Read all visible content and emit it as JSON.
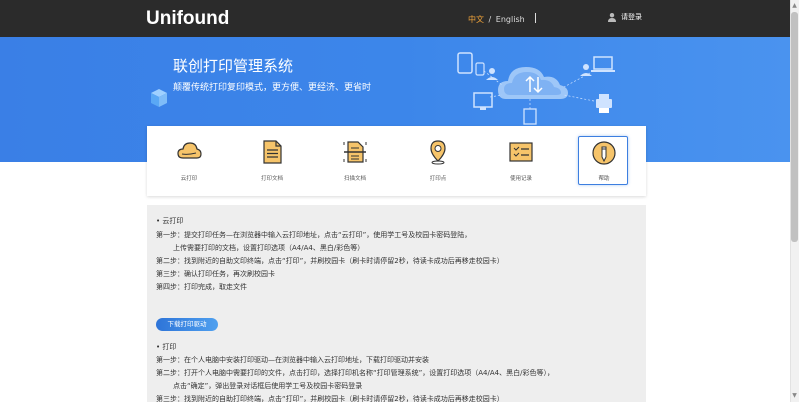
{
  "header": {
    "logo": "Unifound",
    "lang_zh": "中文",
    "lang_sep": "/",
    "lang_en": "English",
    "login": "请登录",
    "accent": "#f0a33a",
    "bg": "#2b2b2b"
  },
  "banner": {
    "title": "联创打印管理系统",
    "subtitle": "颠覆传统打印复印模式，更方便、更经济、更省时",
    "bg": "#3c86ea"
  },
  "cards": [
    {
      "icon": "cloud-print-icon",
      "label": "云打印"
    },
    {
      "icon": "document-icon",
      "label": "打印文档"
    },
    {
      "icon": "scan-document-icon",
      "label": "扫描文档"
    },
    {
      "icon": "location-pin-icon",
      "label": "打印点"
    },
    {
      "icon": "records-icon",
      "label": "使用记录"
    },
    {
      "icon": "help-pencil-icon",
      "label": "帮助",
      "active": true
    }
  ],
  "help": {
    "cloud_title": "• 云打印",
    "cloud_steps": [
      "第一步：提交打印任务—在浏览器中输入云打印地址，点击“云打印”，使用学工号及校园卡密码登陆，",
      "上传需要打印的文档，设置打印选项（A4/A4、黑白/彩色等）",
      "第二步：找到附近的自助文印终端，点击“打印”，并刷校园卡（刷卡时请停留2秒，待读卡成功后再移走校园卡）",
      "第三步：确认打印任务，再次刷校园卡",
      "第四步：打印完成，取走文件"
    ],
    "download_button": "下载打印驱动",
    "print_title": "• 打印",
    "print_steps": [
      "第一步：在个人电脑中安装打印驱动—在浏览器中输入云打印地址，下载打印驱动并安装",
      "第二步：打开个人电脑中需要打印的文件，点击打印，选择打印机名称“打印管理系统”，设置打印选项（A4/A4、黑白/彩色等），",
      "点击“确定”，弹出登录对话框后使用学工号及校园卡密码登录",
      "第三步：找到附近的自助打印终端，点击“打印”，并刷校园卡（刷卡时请停留2秒，待读卡成功后再移走校园卡）"
    ]
  }
}
